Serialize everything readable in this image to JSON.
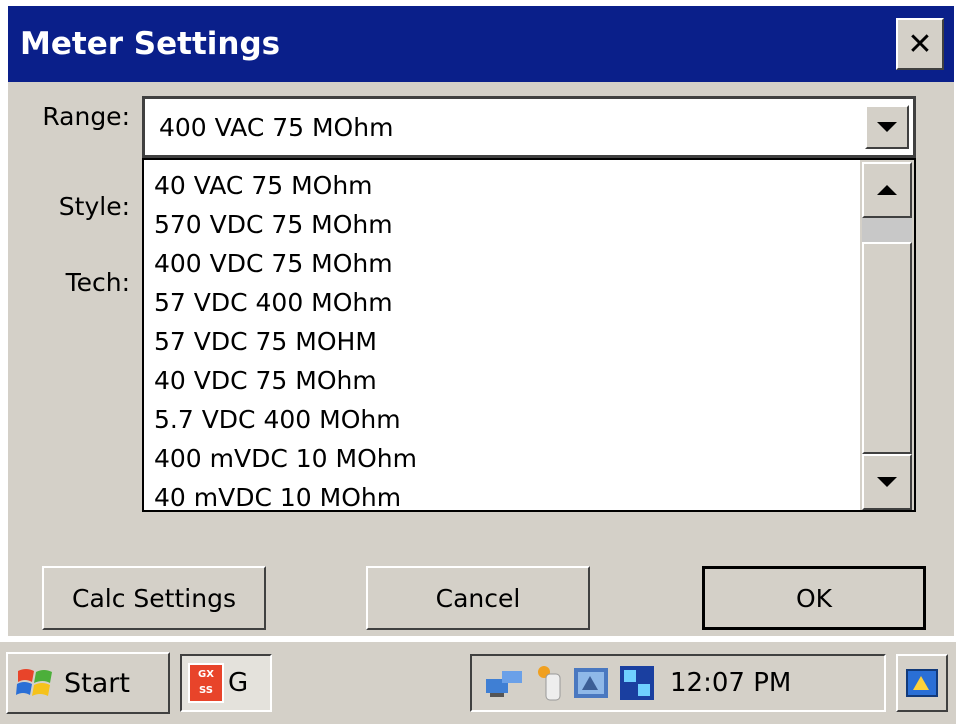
{
  "window": {
    "title": "Meter Settings",
    "close_glyph": "✕"
  },
  "form": {
    "range_label": "Range:",
    "style_label": "Style:",
    "tech_label": "Tech:",
    "range_value": "400 VAC 75 MOhm"
  },
  "dropdown": {
    "items": [
      "40 VAC 75 MOhm",
      "570 VDC 75 MOhm",
      "400 VDC 75 MOhm",
      "57 VDC 400 MOhm",
      "57 VDC 75 MOHM",
      "40 VDC 75 MOhm",
      "5.7 VDC 400 MOhm",
      "400 mVDC 10 MOhm",
      "40 mVDC 10 MOhm"
    ]
  },
  "buttons": {
    "calc": "Calc Settings",
    "cancel": "Cancel",
    "ok": "OK"
  },
  "taskbar": {
    "start_label": "Start",
    "app_text": "G",
    "app_icon_text": "GX SS",
    "clock": "12:07 PM",
    "tray_icons": [
      "network-icon",
      "bluetooth-icon",
      "sync-icon",
      "utg-vnt-icon"
    ]
  },
  "colors": {
    "title_bar": "#0a1f8a",
    "window_bg": "#d4d0c8"
  }
}
